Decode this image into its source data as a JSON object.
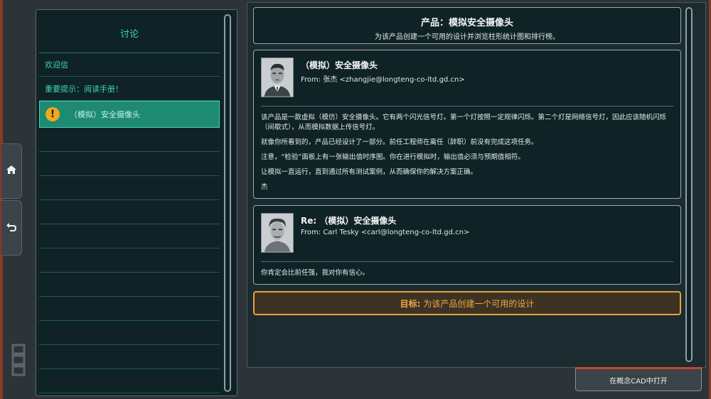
{
  "discussion": {
    "title": "讨论",
    "items": [
      {
        "label": "欢迎信"
      },
      {
        "label": "重要提示：阅读手册！"
      },
      {
        "label": "（模拟）安全摄像头",
        "icon": "warning-icon"
      }
    ]
  },
  "header": {
    "title": "产品：模拟安全摄像头",
    "subtitle": "为该产品创建一个可用的设计并浏览柱形统计图和排行榜。"
  },
  "messages": [
    {
      "subject": "（模拟）安全摄像头",
      "from": "From: 张杰 <zhangjie@longteng-co-ltd.gd.cn>",
      "avatar_icon": "portrait-zhangjie",
      "body": [
        "该产品是一款虚拟（模仿）安全摄像头。它有两个闪光信号灯。第一个灯按照一定规律闪烁。第二个灯是网络信号灯，因此应该随机闪烁（间歇式），从而模拟数据上传信号灯。",
        "就像你所看到的，产品已经设计了一部分。前任工程师在离任（辞职）前没有完成这项任务。",
        "注意，“检验”面板上有一张输出值时序图。你在进行模拟时，输出值必须与预期值相符。",
        "让模拟一直运行，直到通过所有测试案例，从而确保你的解决方案正确。",
        "杰"
      ]
    },
    {
      "subject": "Re: （模拟）安全摄像头",
      "from": "From: Carl Tesky <carl@longteng-co-ltd.gd.cn>",
      "avatar_icon": "portrait-carl",
      "body": [
        "你肯定会比前任强，我对你有信心。"
      ]
    }
  ],
  "goal": {
    "prefix": "目标:",
    "text": "为该产品创建一个可用的设计"
  },
  "actions": {
    "open_cad": "在概念CAD中打开"
  },
  "icons": {
    "home": "home-icon",
    "back": "back-icon",
    "logo": "logo-icon"
  },
  "colors": {
    "accent_teal": "#3fd6b0",
    "goal_orange": "#e8a33a",
    "warning": "#f0a81e"
  }
}
